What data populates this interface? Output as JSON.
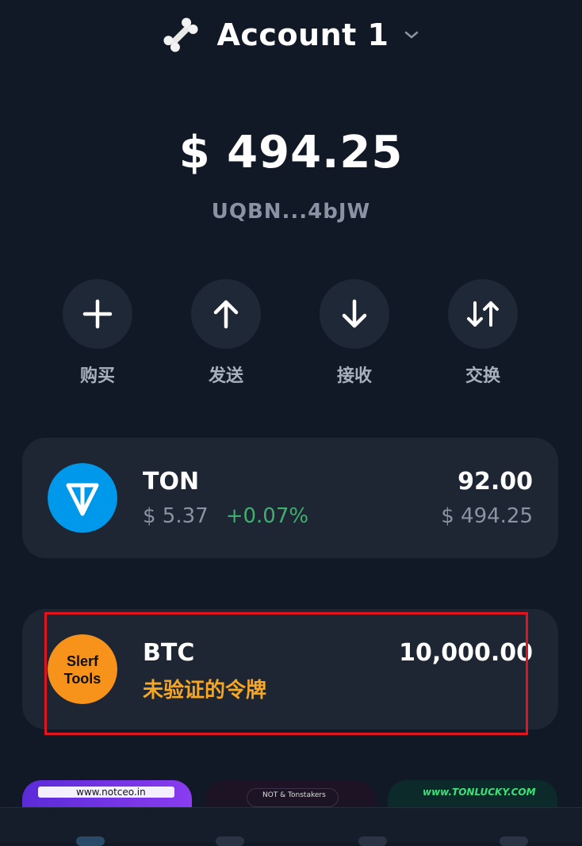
{
  "header": {
    "account_name": "Account 1",
    "account_icon": "bone-icon",
    "dropdown_icon": "chevron-down-icon"
  },
  "wallet": {
    "balance": "$ 494.25",
    "address": "UQBN...4bJW"
  },
  "actions": [
    {
      "label": "购买",
      "icon": "plus-icon"
    },
    {
      "label": "发送",
      "icon": "arrow-up-icon"
    },
    {
      "label": "接收",
      "icon": "arrow-down-icon"
    },
    {
      "label": "交换",
      "icon": "swap-icon"
    }
  ],
  "tokens": [
    {
      "name": "TON",
      "price": "$ 5.37",
      "change": "+0.07%",
      "amount": "92.00",
      "value": "$ 494.25",
      "icon": "ton-logo-icon"
    },
    {
      "name": "BTC",
      "warning": "未验证的令牌",
      "amount": "10,000.00",
      "icon": "slerf-tools-logo-icon",
      "logo_text": "Slerf Tools"
    }
  ],
  "banners": [
    {
      "text": "www.notceo.in"
    },
    {
      "text": "NOT & Tonstakers"
    },
    {
      "text": "www.TONLUCKY.COM"
    }
  ],
  "colors": {
    "background": "#111926",
    "card": "#1e2633",
    "positive": "#3fae6f",
    "warning": "#f5a623",
    "ton_blue": "#0098ea",
    "highlight": "#e0141e"
  }
}
